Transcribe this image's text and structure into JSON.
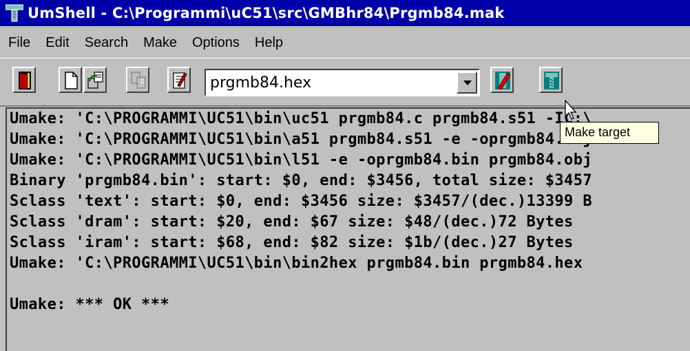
{
  "window": {
    "title": "UmShell - C:\\Programmi\\uC51\\src\\GMBhr84\\Prgmb84.mak"
  },
  "menu": {
    "items": [
      {
        "label": "File"
      },
      {
        "label": "Edit"
      },
      {
        "label": "Search"
      },
      {
        "label": "Make"
      },
      {
        "label": "Options"
      },
      {
        "label": "Help"
      }
    ]
  },
  "toolbar": {
    "target_value": "prgmb84.hex"
  },
  "tooltip": {
    "text": "Make target"
  },
  "output": {
    "lines": [
      "Umake: 'C:\\PROGRAMMI\\UC51\\bin\\uc51 prgmb84.c prgmb84.s51 -IC:\\",
      "Umake: 'C:\\PROGRAMMI\\UC51\\bin\\a51 prgmb84.s51 -e -oprgmb84.obj",
      "Umake: 'C:\\PROGRAMMI\\UC51\\bin\\l51 -e -oprgmb84.bin prgmb84.obj",
      "Binary 'prgmb84.bin': start: $0, end: $3456, total size: $3457",
      "Sclass 'text': start: $0, end: $3456 size: $3457/(dec.)13399 B",
      "Sclass 'dram': start: $20, end: $67 size: $48/(dec.)72 Bytes",
      "Sclass 'iram': start: $68, end: $82 size: $1b/(dec.)27 Bytes",
      "Umake: 'C:\\PROGRAMMI\\UC51\\bin\\bin2hex prgmb84.bin prgmb84.hex",
      "",
      "Umake: *** OK ***"
    ]
  }
}
